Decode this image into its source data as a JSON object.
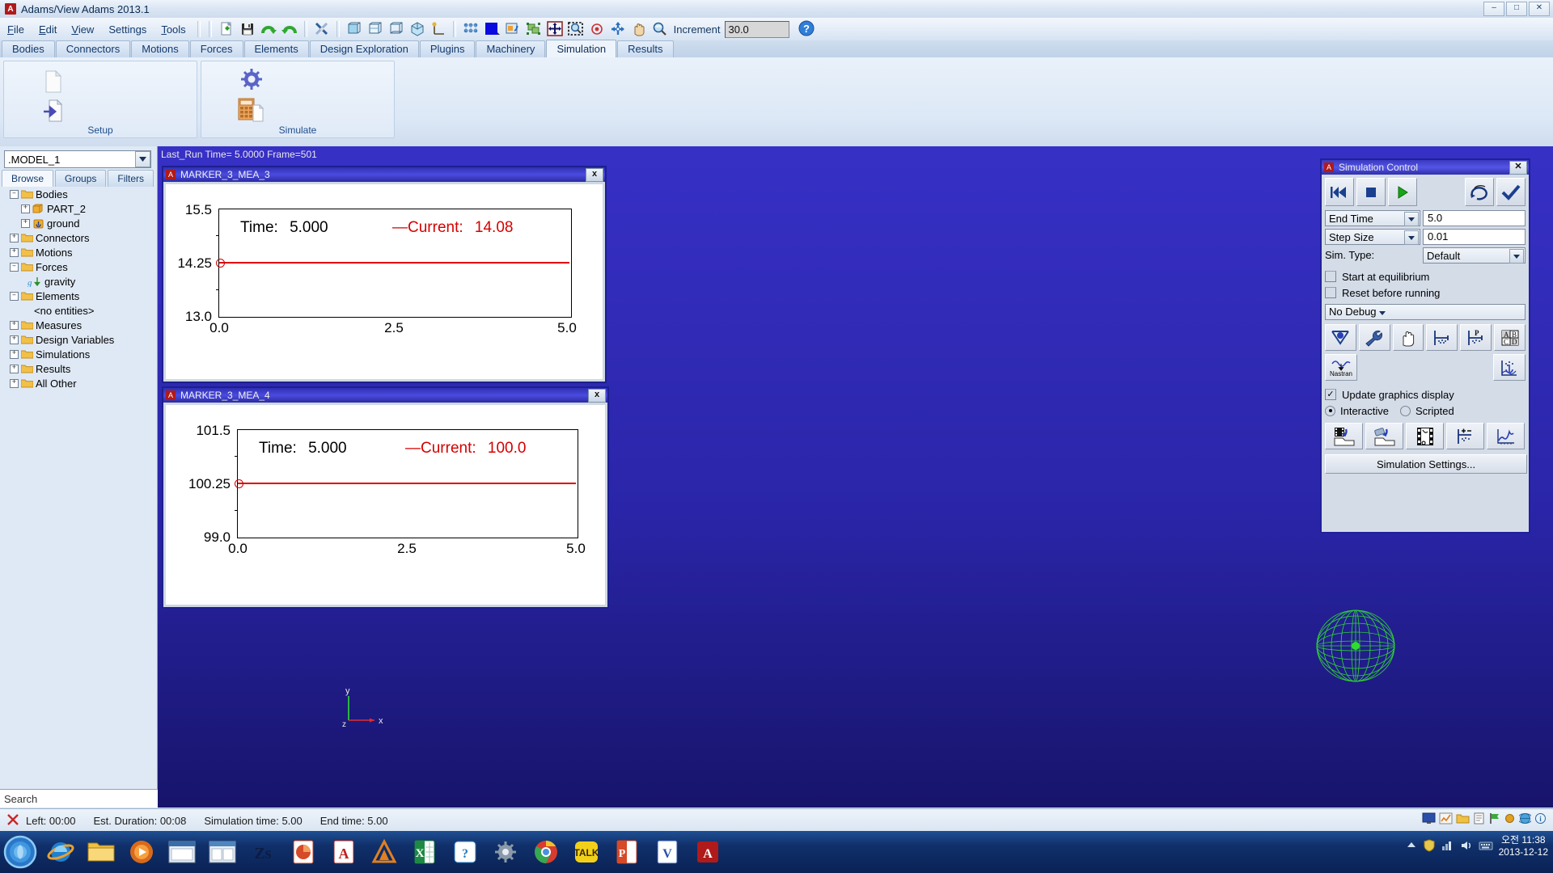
{
  "window": {
    "title": "Adams/View Adams 2013.1",
    "badge": "A",
    "minimize": "–",
    "maximize": "□",
    "close": "✕"
  },
  "menubar": {
    "items": [
      "File",
      "Edit",
      "View",
      "Settings",
      "Tools"
    ],
    "increment_label": "Increment",
    "increment_value": "30.0",
    "icons": [
      "new-file-icon",
      "save-icon",
      "redo-icon",
      "undo-icon",
      "tools-icon",
      "box-front-icon",
      "box-iso-icon",
      "box-wire-icon",
      "shaded-icon",
      "axis-icon",
      "grid-points-icon",
      "color-swatch-icon",
      "render-icon",
      "select-group-icon",
      "fit-view-icon",
      "zoom-box-icon",
      "center-icon",
      "rotate-icon",
      "pan-icon",
      "zoom-icon",
      "help-icon"
    ]
  },
  "ribbon": {
    "tabs": [
      {
        "label": "Bodies",
        "active": false
      },
      {
        "label": "Connectors",
        "active": false
      },
      {
        "label": "Motions",
        "active": false
      },
      {
        "label": "Forces",
        "active": false
      },
      {
        "label": "Elements",
        "active": false
      },
      {
        "label": "Design Exploration",
        "active": false
      },
      {
        "label": "Plugins",
        "active": false
      },
      {
        "label": "Machinery",
        "active": false
      },
      {
        "label": "Simulation",
        "active": true
      },
      {
        "label": "Results",
        "active": false
      }
    ],
    "groups": [
      {
        "label": "Setup",
        "icons": [
          "new-document-icon",
          "import-document-icon"
        ]
      },
      {
        "label": "Simulate",
        "icons": [
          "gear-icon",
          "calculator-icon"
        ]
      }
    ]
  },
  "sidebar": {
    "model_name": ".MODEL_1",
    "tabs": [
      {
        "label": "Browse",
        "active": true
      },
      {
        "label": "Groups",
        "active": false
      },
      {
        "label": "Filters",
        "active": false
      }
    ],
    "search_placeholder": "Search",
    "tree": [
      {
        "label": "Bodies",
        "indent": 0,
        "expander": "-",
        "icon": "folder-icon"
      },
      {
        "label": "PART_2",
        "indent": 1,
        "expander": "+",
        "icon": "part-icon"
      },
      {
        "label": "ground",
        "indent": 1,
        "expander": "+",
        "icon": "ground-icon"
      },
      {
        "label": "Connectors",
        "indent": 0,
        "expander": "+",
        "icon": "folder-icon"
      },
      {
        "label": "Motions",
        "indent": 0,
        "expander": "+",
        "icon": "folder-icon"
      },
      {
        "label": "Forces",
        "indent": 0,
        "expander": "-",
        "icon": "folder-icon"
      },
      {
        "label": "gravity",
        "indent": 1,
        "expander": "",
        "icon": "gravity-icon"
      },
      {
        "label": "Elements",
        "indent": 0,
        "expander": "-",
        "icon": "folder-icon"
      },
      {
        "label": "<no entities>",
        "indent": 1,
        "expander": "",
        "icon": "none"
      },
      {
        "label": "Measures",
        "indent": 0,
        "expander": "+",
        "icon": "folder-icon"
      },
      {
        "label": "Design Variables",
        "indent": 0,
        "expander": "+",
        "icon": "folder-icon"
      },
      {
        "label": "Simulations",
        "indent": 0,
        "expander": "+",
        "icon": "folder-icon"
      },
      {
        "label": "Results",
        "indent": 0,
        "expander": "+",
        "icon": "folder-icon"
      },
      {
        "label": "All Other",
        "indent": 0,
        "expander": "+",
        "icon": "folder-icon"
      }
    ]
  },
  "viewport": {
    "status": "Last_Run   Time= 5.0000  Frame=501",
    "axis_x": "x",
    "axis_y": "y",
    "axis_z": "z",
    "model_color": "#2fdd2f"
  },
  "plots": [
    {
      "title": "MARKER_3_MEA_3",
      "badge": "A",
      "close": "x",
      "time_label": "Time:",
      "time_value": "5.000",
      "current_label": "Current:",
      "current_value": "14.08",
      "series_color": "#e00000",
      "chart_data": {
        "type": "line",
        "title": "MARKER_3_MEA_3",
        "xlabel": "",
        "ylabel": "",
        "x": [
          0.0,
          1.25,
          2.5,
          3.75,
          5.0
        ],
        "values": [
          14.08,
          14.08,
          14.08,
          14.08,
          14.08
        ],
        "series": [
          {
            "name": "Current",
            "values": [
              14.08,
              14.08,
              14.08,
              14.08,
              14.08
            ]
          }
        ],
        "xticks": [
          "0.0",
          "2.5",
          "5.0"
        ],
        "yticks": [
          "15.5",
          "14.25",
          "13.0"
        ],
        "xlim": [
          0.0,
          5.0
        ],
        "ylim": [
          13.0,
          15.5
        ],
        "grid": false,
        "legend": "top"
      }
    },
    {
      "title": "MARKER_3_MEA_4",
      "badge": "A",
      "close": "x",
      "time_label": "Time:",
      "time_value": "5.000",
      "current_label": "Current:",
      "current_value": "100.0",
      "series_color": "#e00000",
      "chart_data": {
        "type": "line",
        "title": "MARKER_3_MEA_4",
        "xlabel": "",
        "ylabel": "",
        "x": [
          0.0,
          1.25,
          2.5,
          3.75,
          5.0
        ],
        "values": [
          100.0,
          100.0,
          100.0,
          100.0,
          100.0
        ],
        "series": [
          {
            "name": "Current",
            "values": [
              100.0,
              100.0,
              100.0,
              100.0,
              100.0
            ]
          }
        ],
        "xticks": [
          "0.0",
          "2.5",
          "5.0"
        ],
        "yticks": [
          "101.5",
          "100.25",
          "99.0"
        ],
        "xlim": [
          0.0,
          5.0
        ],
        "ylim": [
          99.0,
          101.5
        ],
        "grid": false,
        "legend": "top"
      }
    }
  ],
  "simulation_control": {
    "title": "Simulation Control",
    "badge": "A",
    "close": "✕",
    "transport": [
      "rewind-icon",
      "stop-icon",
      "play-icon",
      "reset-icon",
      "apply-check-icon"
    ],
    "end_time_label": "End Time",
    "end_time_value": "5.0",
    "step_size_label": "Step Size",
    "step_size_value": "0.01",
    "sim_type_label": "Sim. Type:",
    "sim_type_value": "Default",
    "start_at_equilibrium": "Start at equilibrium",
    "start_at_equilibrium_checked": false,
    "reset_before_running": "Reset before running",
    "reset_before_running_checked": false,
    "debug_value": "No Debug",
    "tool_icons_row1": [
      "equilibrium-icon",
      "wrench-icon",
      "hand-icon",
      "measure-icon",
      "pressure-measure-icon",
      "abcd-icon"
    ],
    "tool_icons_row2": [
      "nastran-icon",
      "plot-anchor-icon"
    ],
    "nastran_label": "Nastran",
    "update_graphics": "Update graphics display",
    "update_graphics_checked": true,
    "mode_interactive": "Interactive",
    "mode_scripted": "Scripted",
    "mode_selected": "Interactive",
    "bottom_icons": [
      "save-animation-icon",
      "load-animation-icon",
      "film-icon",
      "plus-minus-icon",
      "results-plot-icon"
    ],
    "settings_button": "Simulation Settings..."
  },
  "statusbar": {
    "left_label": "Left: 00:00",
    "duration_label": "Est. Duration: 00:08",
    "sim_time_label": "Simulation time: 5.00",
    "end_time_label": "End time: 5.00",
    "icons": [
      "monitor-icon",
      "chart-icon",
      "folder-icon",
      "note-icon",
      "flag-icon",
      "dot-icon",
      "globe-icon",
      "info-icon"
    ]
  },
  "taskbar": {
    "start": "start-orb",
    "apps": [
      "internet-explorer-icon",
      "folder-explorer-icon",
      "media-icon",
      "window-icon",
      "window2-icon",
      "zs-icon",
      "powerpoint-icon",
      "acrobat-icon",
      "adams-icon",
      "excel-icon",
      "messenger-icon",
      "settings-icon",
      "chrome-icon",
      "talk-icon",
      "powerpoint2-icon",
      "word-icon",
      "adams2-icon"
    ],
    "tray_icons": [
      "arrow-up-icon",
      "shield-icon",
      "network-icon",
      "volume-icon",
      "keyboard-icon"
    ],
    "clock_time": "오전 11:38",
    "clock_date": "2013-12-12"
  }
}
